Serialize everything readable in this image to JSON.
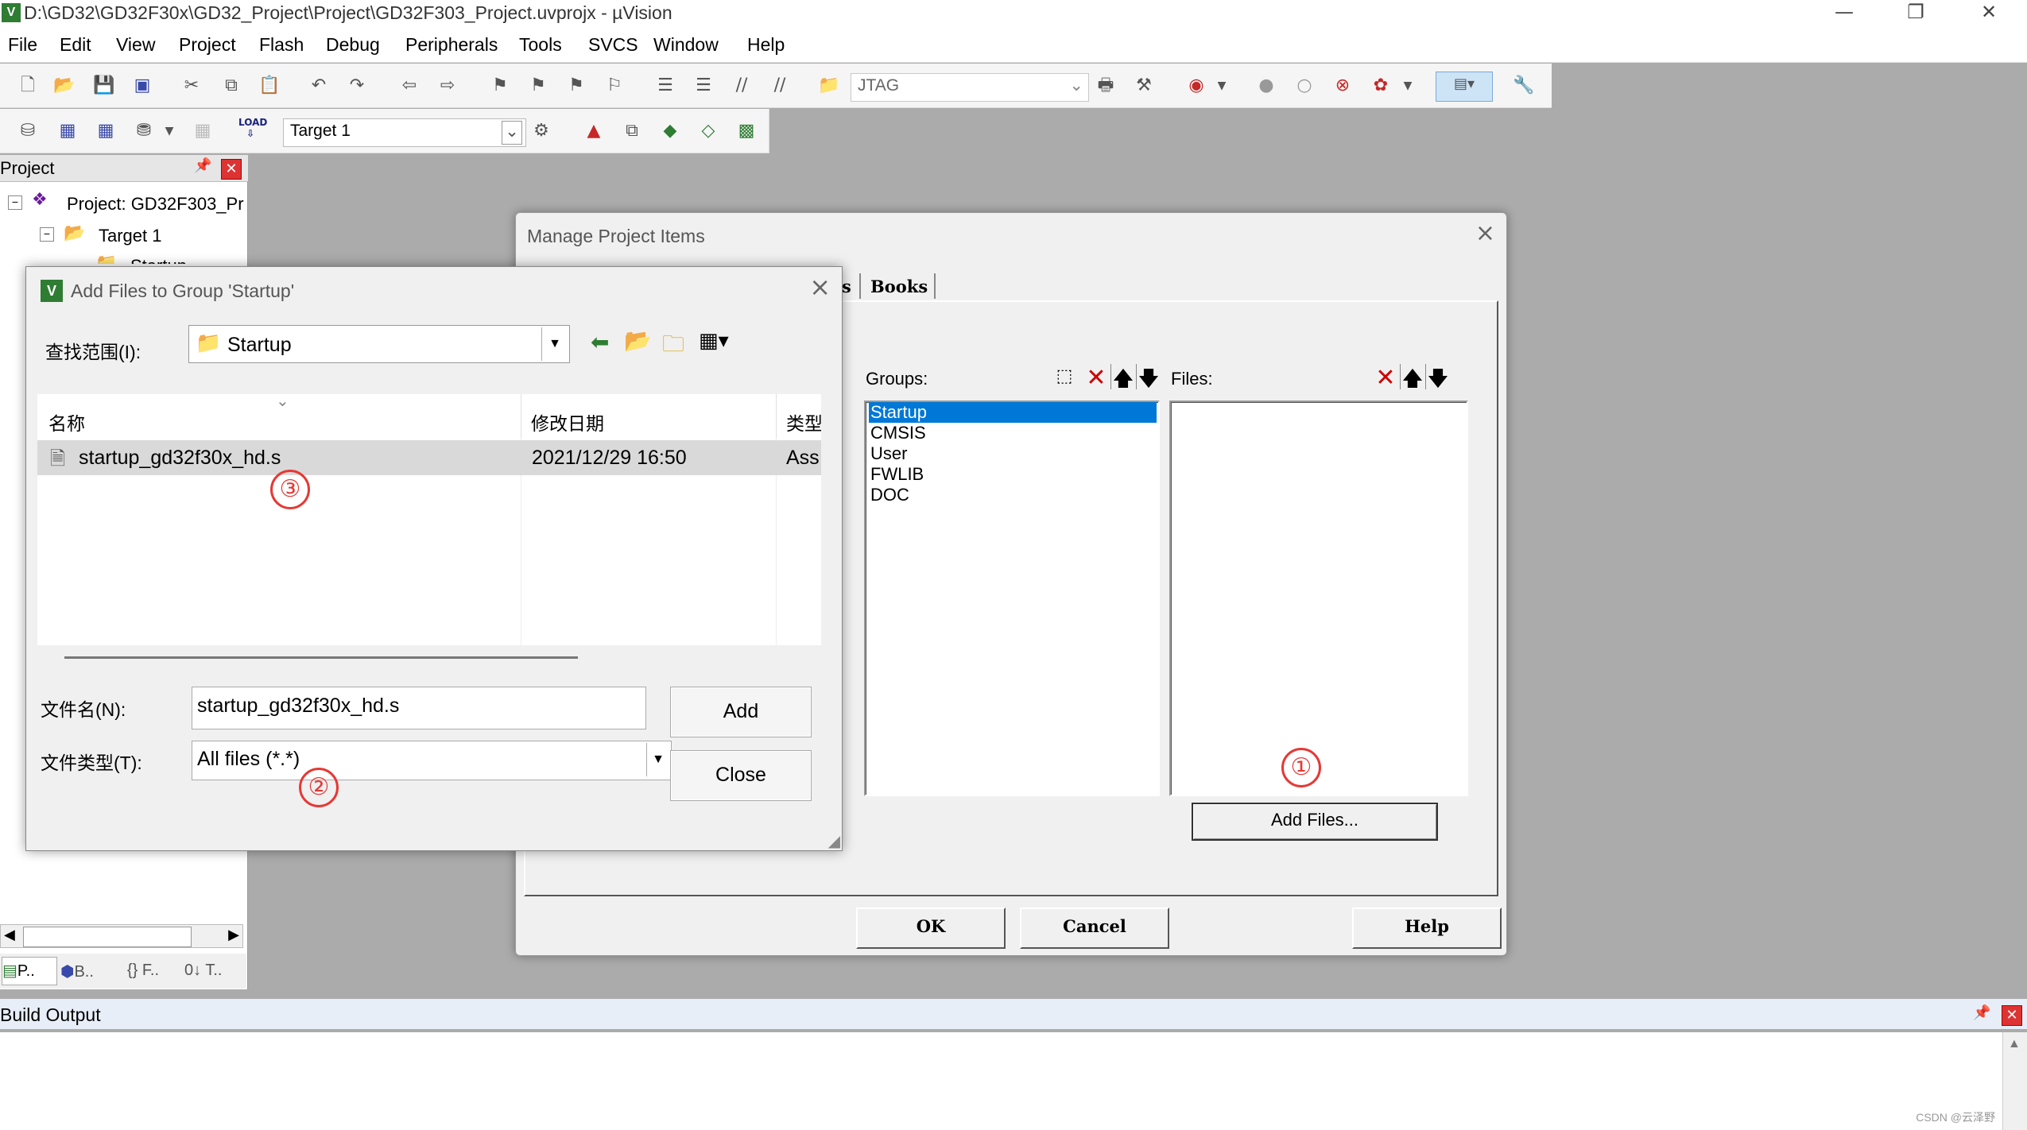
{
  "window": {
    "title": "D:\\GD32\\GD32F30x\\GD32_Project\\Project\\GD32F303_Project.uvprojx - µVision",
    "controls": [
      "—",
      "❐",
      "✕"
    ]
  },
  "menu": [
    "File",
    "Edit",
    "View",
    "Project",
    "Flash",
    "Debug",
    "Peripherals",
    "Tools",
    "SVCS",
    "Window",
    "Help"
  ],
  "toolbar": {
    "debug_interface": "JTAG",
    "target": "Target 1",
    "load_label": "LOAD"
  },
  "project_panel": {
    "title": "Project",
    "root": "Project: GD32F303_Pr",
    "target": "Target 1",
    "child": "Startup",
    "tabs": [
      "P..",
      "B..",
      "{} F..",
      "0↓ T.."
    ]
  },
  "build_output": {
    "title": "Build Output",
    "watermark": "CSDN @云泽野"
  },
  "manage_dialog": {
    "title": "Manage Project Items",
    "tab_partial": "s",
    "tab_books": "Books",
    "groups_label": "Groups:",
    "files_label": "Files:",
    "groups": [
      "Startup",
      "CMSIS",
      "User",
      "FWLIB",
      "DOC"
    ],
    "selected_group": "Startup",
    "add_files_label": "Add Files...",
    "ok_label": "OK",
    "cancel_label": "Cancel",
    "help_label": "Help"
  },
  "add_files_dialog": {
    "title": "Add Files to Group 'Startup'",
    "look_in_label": "查找范围(I):",
    "look_in_value": "Startup",
    "columns": [
      "名称",
      "修改日期",
      "类型"
    ],
    "files": [
      {
        "name": "startup_gd32f30x_hd.s",
        "modified": "2021/12/29 16:50",
        "type": "Ass"
      }
    ],
    "filename_label": "文件名(N):",
    "filename_value": "startup_gd32f30x_hd.s",
    "filetype_label": "文件类型(T):",
    "filetype_value": "All files (*.*)",
    "add_label": "Add",
    "close_label": "Close"
  },
  "callouts": [
    "①",
    "②",
    "③"
  ],
  "colors": {
    "selection": "#0078d7",
    "callout": "#e53935",
    "workspace": "#ababab"
  }
}
